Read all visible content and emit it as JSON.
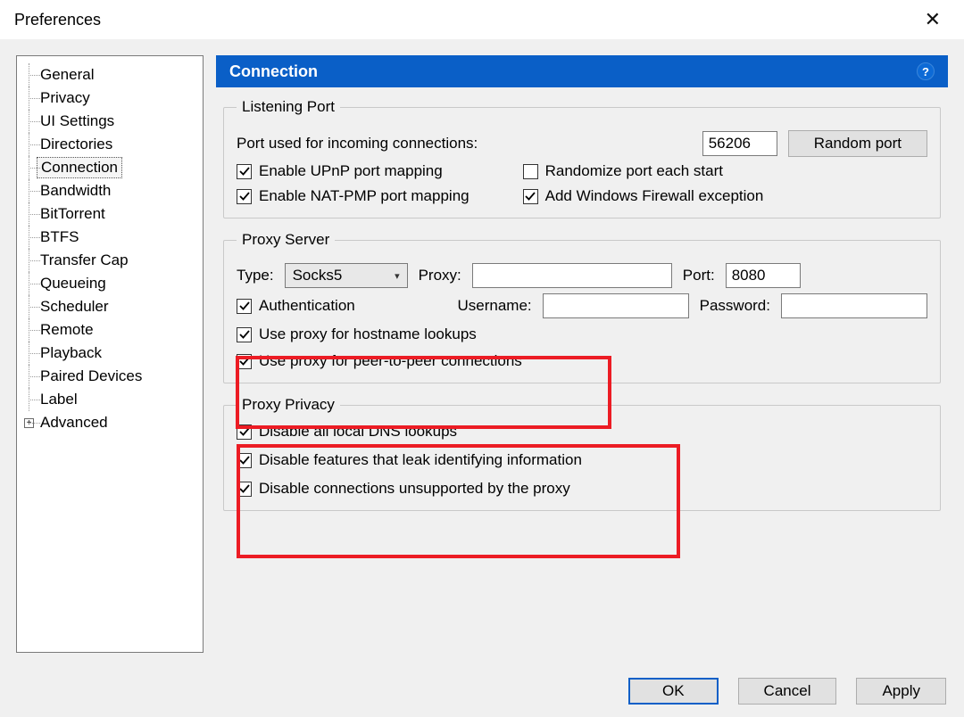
{
  "window": {
    "title": "Preferences"
  },
  "tree": {
    "items": [
      {
        "label": "General"
      },
      {
        "label": "Privacy"
      },
      {
        "label": "UI Settings"
      },
      {
        "label": "Directories"
      },
      {
        "label": "Connection"
      },
      {
        "label": "Bandwidth"
      },
      {
        "label": "BitTorrent"
      },
      {
        "label": "BTFS"
      },
      {
        "label": "Transfer Cap"
      },
      {
        "label": "Queueing"
      },
      {
        "label": "Scheduler"
      },
      {
        "label": "Remote"
      },
      {
        "label": "Playback"
      },
      {
        "label": "Paired Devices"
      },
      {
        "label": "Label"
      },
      {
        "label": "Advanced"
      }
    ],
    "selected": "Connection"
  },
  "panel": {
    "title": "Connection",
    "help_char": "?"
  },
  "listening": {
    "legend": "Listening Port",
    "port_label": "Port used for incoming connections:",
    "port_value": "56206",
    "random_btn": "Random port",
    "chk_upnp": "Enable UPnP port mapping",
    "chk_natpmp": "Enable NAT-PMP port mapping",
    "chk_randomize": "Randomize port each start",
    "chk_firewall": "Add Windows Firewall exception"
  },
  "proxy": {
    "legend": "Proxy Server",
    "type_label": "Type:",
    "type_value": "Socks5",
    "proxy_label": "Proxy:",
    "proxy_value": "",
    "port_label": "Port:",
    "port_value": "8080",
    "chk_auth": "Authentication",
    "user_label": "Username:",
    "user_value": "",
    "pass_label": "Password:",
    "pass_value": "",
    "chk_hostname": "Use proxy for hostname lookups",
    "chk_p2p": "Use proxy for peer-to-peer connections"
  },
  "privacy": {
    "legend": "Proxy Privacy",
    "chk_dns": "Disable all local DNS lookups",
    "chk_leak": "Disable features that leak identifying information",
    "chk_unsupported": "Disable connections unsupported by the proxy"
  },
  "buttons": {
    "ok": "OK",
    "cancel": "Cancel",
    "apply": "Apply"
  }
}
